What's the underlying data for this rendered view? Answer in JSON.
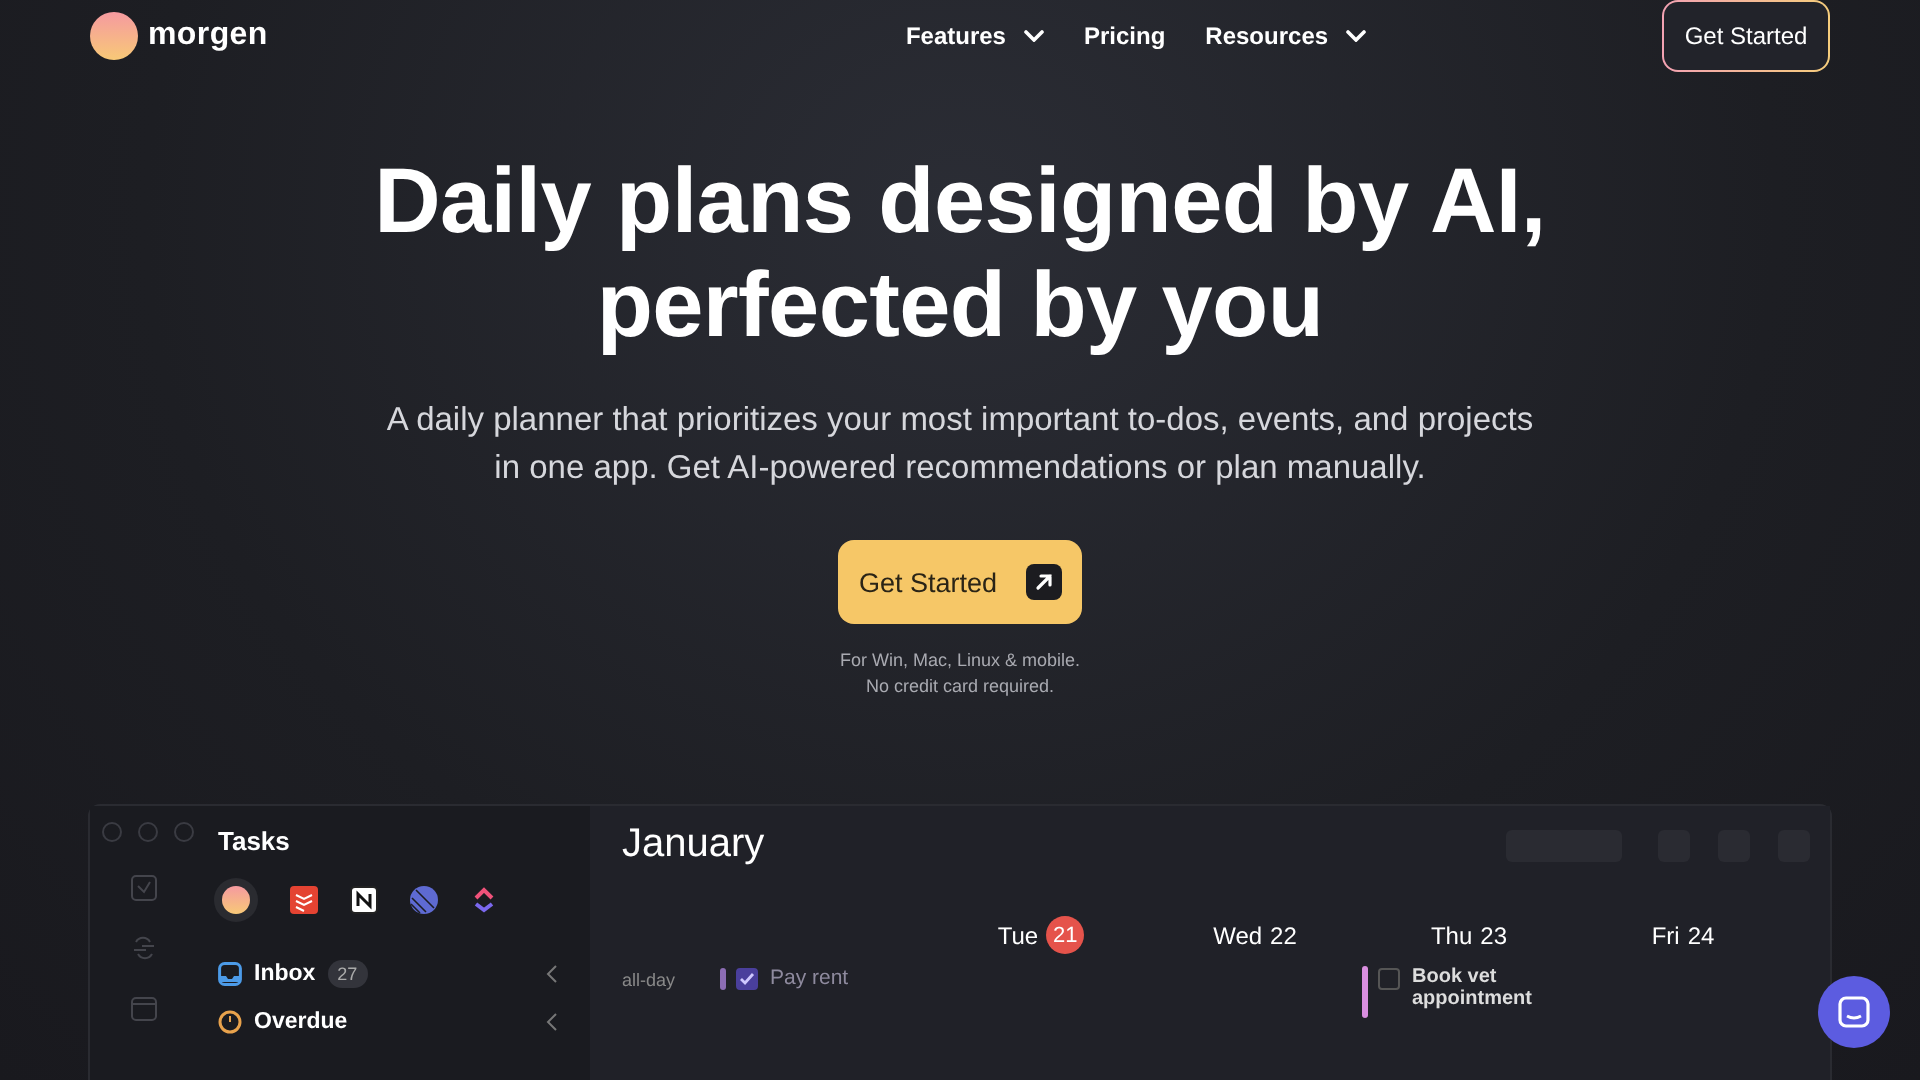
{
  "nav": {
    "brand": "morgen",
    "links": [
      {
        "label": "Features",
        "dropdown": true
      },
      {
        "label": "Pricing",
        "dropdown": false
      },
      {
        "label": "Resources",
        "dropdown": true
      }
    ],
    "cta": "Get Started"
  },
  "hero": {
    "title_lines": [
      "Daily plans designed by AI,",
      "perfected by you"
    ],
    "subtitle_lines": [
      "A daily planner that prioritizes your most important to-dos, events, and projects",
      "in one app. Get AI-powered recommendations or plan manually."
    ],
    "cta": "Get Started",
    "notes": [
      "For Win, Mac, Linux & mobile.",
      "No credit card required."
    ]
  },
  "app": {
    "sidebar": {
      "title": "Tasks",
      "items": [
        {
          "label": "Inbox",
          "count": "27",
          "kind": "inbox"
        },
        {
          "label": "Overdue",
          "kind": "overdue"
        }
      ]
    },
    "calendar": {
      "month": "January",
      "all_day_label": "all-day",
      "all_day_items": [
        {
          "title": "Pay rent",
          "checked": true,
          "color": "#8c6db4"
        }
      ],
      "days": [
        {
          "name": "Tue",
          "date": "21",
          "today": true
        },
        {
          "name": "Wed",
          "date": "22",
          "today": false
        },
        {
          "name": "Thu",
          "date": "23",
          "today": false,
          "events": [
            {
              "title": "Book vet appointment",
              "checked": false,
              "color": "#d98ee0"
            }
          ]
        },
        {
          "name": "Fri",
          "date": "24",
          "today": false
        }
      ]
    }
  }
}
